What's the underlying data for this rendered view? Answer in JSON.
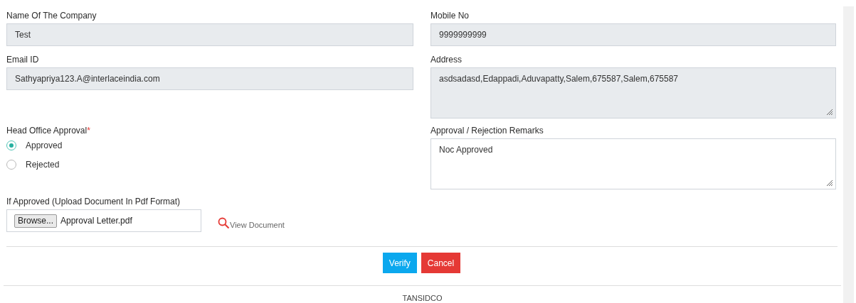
{
  "fields": [
    {
      "kind": "input",
      "label": "Name Of The Company",
      "value": "Test",
      "readonly": true
    },
    {
      "kind": "input",
      "label": "Mobile No",
      "value": "9999999999",
      "readonly": true
    },
    {
      "kind": "input",
      "label": "Email ID",
      "value": "Sathyapriya123.A@interlaceindia.com",
      "readonly": true
    },
    {
      "kind": "textarea",
      "label": "Address",
      "value": "asdsadasd,Edappadi,Aduvapatty,Salem,675587,Salem,675587",
      "readonly": true
    },
    {
      "kind": "radio",
      "label": "Head Office Approval",
      "required_mark": "*",
      "options": [
        {
          "label": "Approved",
          "selected": true
        },
        {
          "label": "Rejected",
          "selected": false
        }
      ]
    },
    {
      "kind": "textarea",
      "label": "Approval / Rejection Remarks",
      "value": "Noc Approved",
      "readonly": false
    },
    {
      "kind": "upload",
      "label": "If Approved (Upload Document In Pdf Format)",
      "button": "Browse...",
      "file": "Approval Letter.pdf",
      "link": "View Document"
    }
  ],
  "actions": [
    {
      "kind": "primary",
      "label": "Verify"
    },
    {
      "kind": "danger",
      "label": "Cancel"
    }
  ],
  "footer": "TANSIDCO"
}
